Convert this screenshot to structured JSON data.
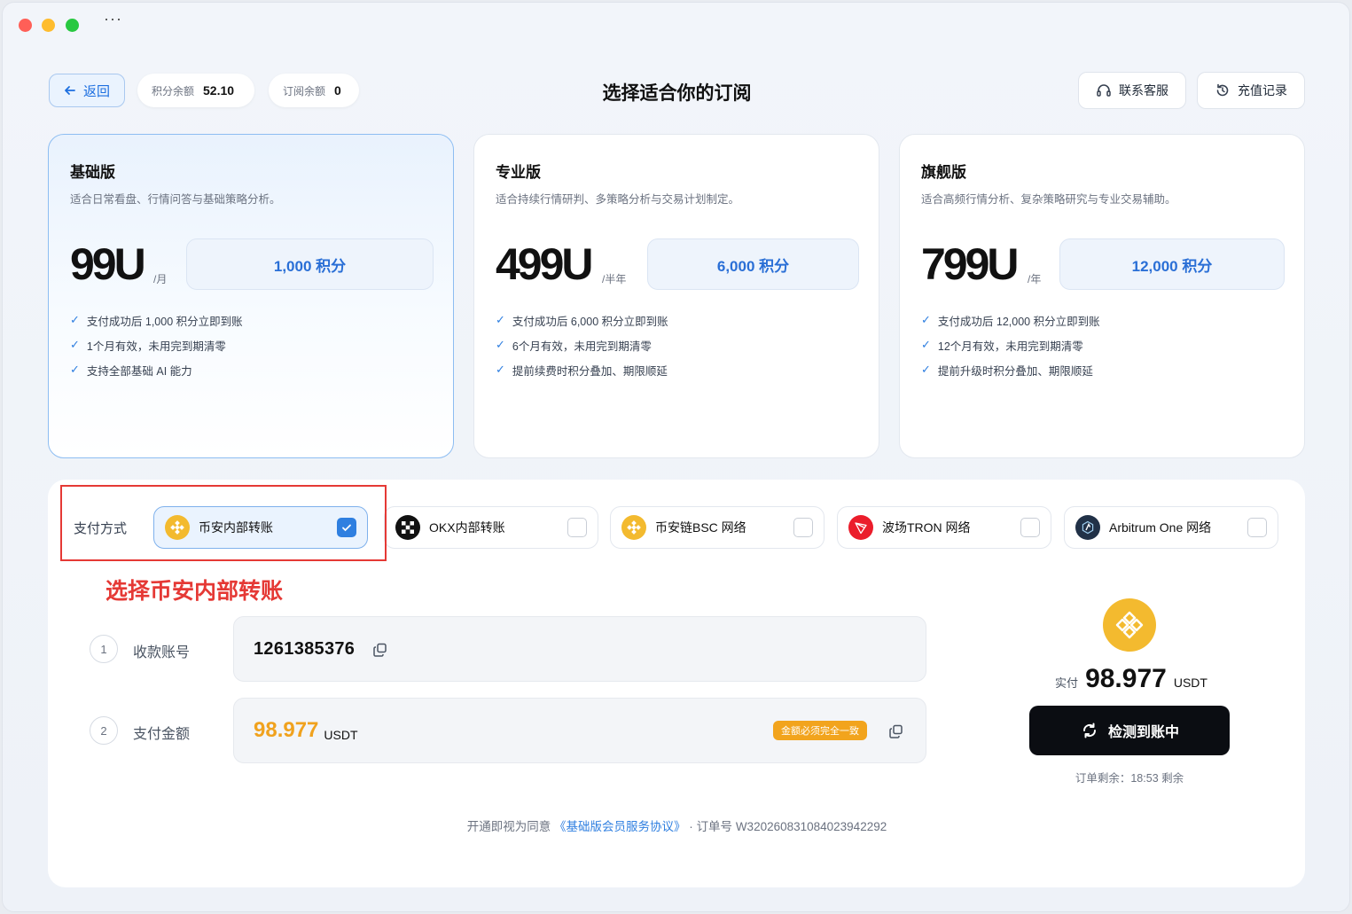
{
  "window": {
    "more_label": "···"
  },
  "header": {
    "back_label": "返回",
    "points_label": "积分余额",
    "points_value": "52.10",
    "sub_label": "订阅余额",
    "sub_value": "0",
    "title": "选择适合你的订阅",
    "support_label": "联系客服",
    "history_label": "充值记录"
  },
  "plans": [
    {
      "name": "基础版",
      "desc": "适合日常看盘、行情问答与基础策略分析。",
      "price": "99U",
      "period": "/月",
      "credits": "1,000 积分",
      "features": [
        "支付成功后 1,000 积分立即到账",
        "1个月有效，未用完到期清零",
        "支持全部基础 AI 能力"
      ],
      "selected": true
    },
    {
      "name": "专业版",
      "desc": "适合持续行情研判、多策略分析与交易计划制定。",
      "price": "499U",
      "period": "/半年",
      "credits": "6,000 积分",
      "features": [
        "支付成功后 6,000 积分立即到账",
        "6个月有效，未用完到期清零",
        "提前续费时积分叠加、期限顺延"
      ],
      "selected": false
    },
    {
      "name": "旗舰版",
      "desc": "适合高频行情分析、复杂策略研究与专业交易辅助。",
      "price": "799U",
      "period": "/年",
      "credits": "12,000 积分",
      "features": [
        "支付成功后 12,000 积分立即到账",
        "12个月有效，未用完到期清零",
        "提前升级时积分叠加、期限顺延"
      ],
      "selected": false
    }
  ],
  "payment": {
    "label": "支付方式",
    "methods": [
      {
        "name": "币安内部转账",
        "icon": "binance-icon",
        "selected": true
      },
      {
        "name": "OKX内部转账",
        "icon": "okx-icon",
        "selected": false
      },
      {
        "name": "币安链BSC 网络",
        "icon": "bnb-icon",
        "selected": false
      },
      {
        "name": "波场TRON 网络",
        "icon": "tron-icon",
        "selected": false
      },
      {
        "name": "Arbitrum One 网络",
        "icon": "arbitrum-icon",
        "selected": false
      }
    ],
    "annotation": "选择币安内部转账"
  },
  "steps": {
    "s1_num": "1",
    "s1_label": "收款账号",
    "account": "1261385376",
    "s2_num": "2",
    "s2_label": "支付金额",
    "amount": "98.977",
    "amount_unit": "USDT",
    "amount_tag": "金额必须完全一致"
  },
  "summary": {
    "paid_label": "实付",
    "paid_value": "98.977",
    "paid_unit": "USDT",
    "detect_label": "检测到账中",
    "remaining": "订单剩余：18:53 剩余"
  },
  "footer": {
    "prefix": "开通即视为同意",
    "agreement": "《基础版会员服务协议》",
    "sep": "·",
    "order": "订单号 W320260831084023942292"
  },
  "colors": {
    "accent": "#2f7fe0",
    "binance": "#f3ba2f",
    "annotation": "#e53935",
    "amount": "#f0a21e"
  }
}
